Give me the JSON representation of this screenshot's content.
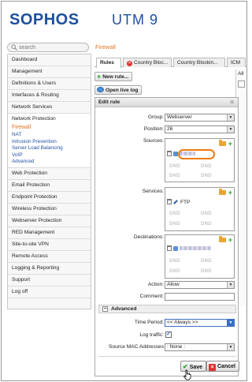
{
  "header": {
    "brand": "SOPHOS",
    "product": "UTM 9"
  },
  "search": {
    "placeholder": "search"
  },
  "breadcrumb": "Firewall",
  "sidebar": {
    "items": [
      {
        "label": "Dashboard"
      },
      {
        "label": "Management"
      },
      {
        "label": "Definitions & Users"
      },
      {
        "label": "Interfaces & Routing"
      },
      {
        "label": "Network Services"
      }
    ],
    "group": {
      "label": "Network Protection",
      "subitems": [
        {
          "label": "Firewall",
          "active": true
        },
        {
          "label": "NAT"
        },
        {
          "label": "Intrusion Prevention"
        },
        {
          "label": "Server Load Balancing"
        },
        {
          "label": "VoIP"
        },
        {
          "label": "Advanced"
        }
      ]
    },
    "items_after": [
      {
        "label": "Web Protection"
      },
      {
        "label": "Email Protection"
      },
      {
        "label": "Endpoint Protection"
      },
      {
        "label": "Wireless Protection"
      },
      {
        "label": "Webserver Protection"
      },
      {
        "label": "RED Management"
      },
      {
        "label": "Site-to-site VPN"
      },
      {
        "label": "Remote Access"
      },
      {
        "label": "Logging & Reporting"
      },
      {
        "label": "Support"
      },
      {
        "label": "Log off"
      }
    ]
  },
  "tabs": [
    {
      "label": "Rules"
    },
    {
      "label": "Country Bloc..."
    },
    {
      "label": "Country Blockin..."
    },
    {
      "label": "ICM"
    }
  ],
  "toolbar": {
    "new_rule": "New rule...",
    "open_live_log": "Open live log",
    "right_col_label": "All"
  },
  "dialog": {
    "title": "Edit rule",
    "group_label": "Group:",
    "group_value": "Webserver",
    "position_label": "Position:",
    "position_value": "26",
    "sources_label": "Sources:",
    "services_label": "Services:",
    "service_entry": "FTP",
    "destinations_label": "Destinations:",
    "dnd": "DND",
    "action_label": "Action:",
    "action_value": "Allow",
    "comment_label": "Comment:",
    "comment_value": "",
    "advanced_label": "Advanced",
    "time_period_label": "Time Period:",
    "time_period_value": "<< Always >>",
    "log_traffic_label": "Log traffic:",
    "log_traffic_checked": "✓",
    "source_mac_label": "Source MAC Addresses",
    "source_mac_value": ": None :",
    "save_label": "Save",
    "cancel_label": "Cancel"
  },
  "colors": {
    "brand_blue": "#1d4f9e",
    "accent_orange": "#e3721d",
    "highlight_orange": "#ee7a12",
    "ok_green": "#2ca02c",
    "cancel_red": "#d33333"
  }
}
